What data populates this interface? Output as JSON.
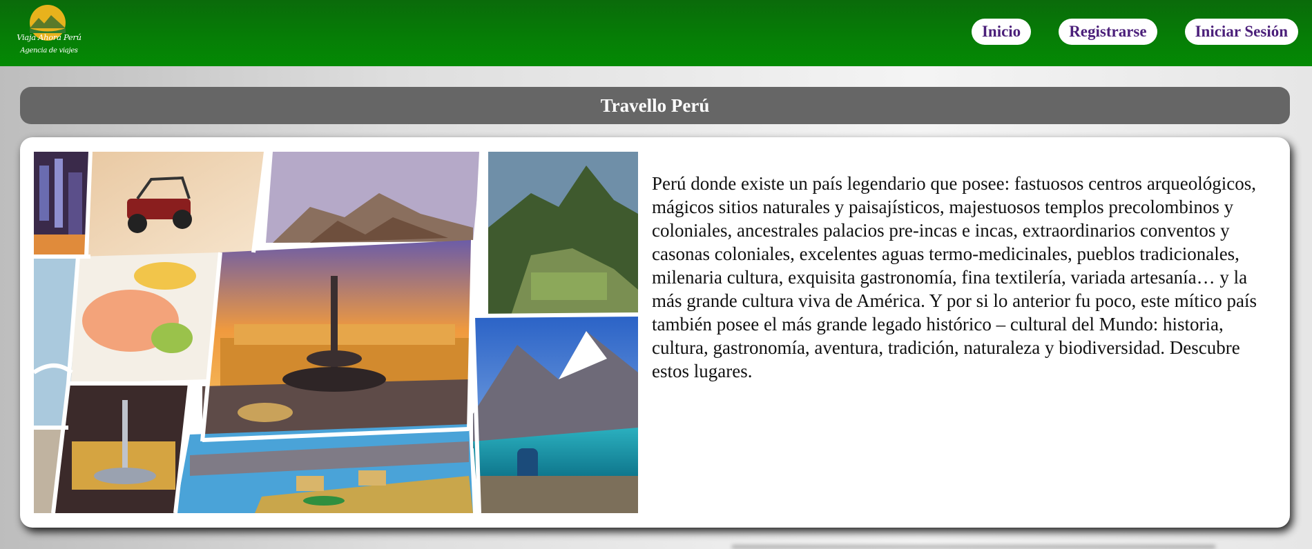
{
  "header": {
    "logo": {
      "icon": "mountain-sun-logo",
      "title": "Viaja Ahora Perú",
      "tagline": "Agencia de viajes"
    },
    "nav": [
      {
        "label": "Inicio"
      },
      {
        "label": "Registrarse"
      },
      {
        "label": "Iniciar Sesión"
      }
    ]
  },
  "main": {
    "title": "Travello Perú",
    "collage_image": "peru-destinations-collage",
    "description": "Perú donde existe un país legendario que posee: fastuosos centros arqueológicos, mágicos sitios naturales y paisajísticos, majestuosos templos precolombinos y coloniales, ancestrales palacios pre-incas e incas, extraordinarios conventos y casonas coloniales, excelentes aguas termo-medicinales, pueblos tradicionales, milenaria cultura, exquisita gastronomía, fina textilería, variada artesanía… y la más grande cultura viva de América. Y por si lo anterior fu poco, este mítico país también posee el más grande legado histórico – cultural del Mundo: historia, cultura, gastronomía, aventura, tradición, naturaleza y biodiversidad. Descubre estos lugares."
  },
  "colors": {
    "navbar": "#067d06",
    "nav_text": "#4b1f7a",
    "titlebar": "#666666"
  }
}
